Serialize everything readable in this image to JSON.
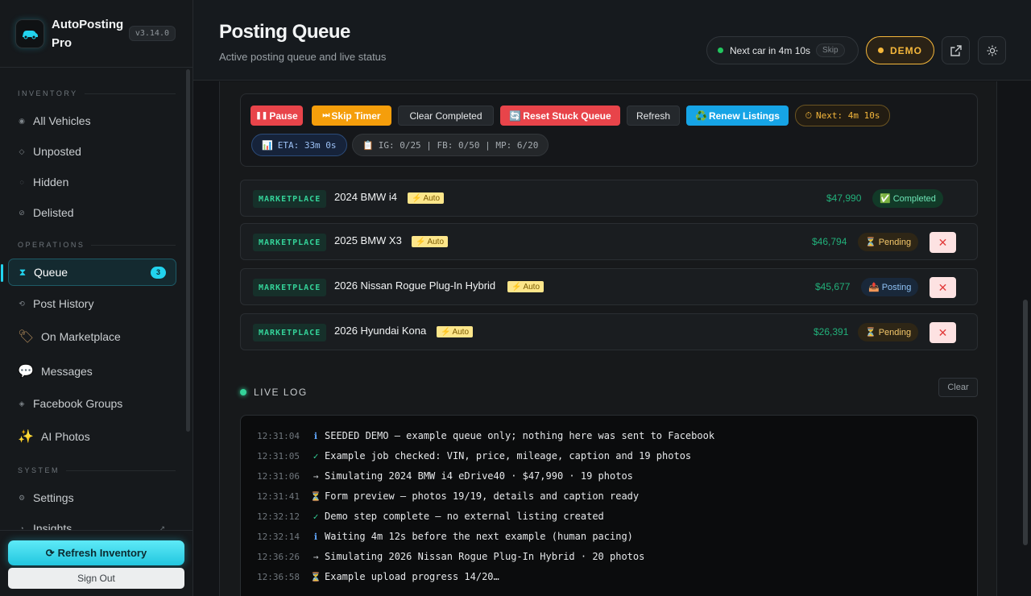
{
  "app": {
    "name": "AutoPosting Pro",
    "version": "v3.14.0"
  },
  "sidebar": {
    "sections": {
      "inventory": "INVENTORY",
      "operations": "OPERATIONS",
      "system": "SYSTEM"
    },
    "items": {
      "all_vehicles": "All Vehicles",
      "unposted": "Unposted",
      "hidden": "Hidden",
      "delisted": "Delisted",
      "queue": "Queue",
      "queue_count": "3",
      "post_history": "Post History",
      "on_marketplace": "On Marketplace",
      "messages": "Messages",
      "facebook_groups": "Facebook Groups",
      "ai_photos": "AI Photos",
      "settings": "Settings",
      "insights": "Insights"
    },
    "refresh_label": "Refresh Inventory",
    "signout_label": "Sign Out"
  },
  "header": {
    "title": "Posting Queue",
    "subtitle": "Active posting queue and live status",
    "next_car": "Next car in 4m 10s",
    "skip": "Skip",
    "demo": "DEMO"
  },
  "controls": {
    "pause": "Pause",
    "skip_timer": "Skip Timer",
    "clear_completed": "Clear Completed",
    "reset_stuck": "Reset Stuck Queue",
    "refresh": "Refresh",
    "renew": "Renew Listings",
    "next": "Next: 4m 10s",
    "eta": "ETA: 33m 0s",
    "counts": "IG: 0/25 | FB: 0/50 | MP: 6/20"
  },
  "queue": [
    {
      "tag": "MARKETPLACE",
      "name": "2024 BMW i4",
      "auto": "Auto",
      "price": "$47,990",
      "status": "Completed",
      "status_icon": "✅",
      "status_type": "completed",
      "removable": false
    },
    {
      "tag": "MARKETPLACE",
      "name": "2025 BMW X3",
      "auto": "Auto",
      "price": "$46,794",
      "status": "Pending",
      "status_icon": "⏳",
      "status_type": "pending",
      "removable": true
    },
    {
      "tag": "MARKETPLACE",
      "name": "2026 Nissan Rogue Plug-In Hybrid",
      "auto": "Auto",
      "price": "$45,677",
      "status": "Posting",
      "status_icon": "📤",
      "status_type": "posting",
      "removable": true
    },
    {
      "tag": "MARKETPLACE",
      "name": "2026 Hyundai Kona",
      "auto": "Auto",
      "price": "$26,391",
      "status": "Pending",
      "status_icon": "⏳",
      "status_type": "pending",
      "removable": true
    }
  ],
  "live_log": {
    "title": "LIVE LOG",
    "clear": "Clear",
    "lines": [
      {
        "time": "12:31:04",
        "icon": "ℹ",
        "type": "info",
        "text": "SEEDED DEMO — example queue only; nothing here was sent to Facebook"
      },
      {
        "time": "12:31:05",
        "icon": "✓",
        "type": "ok",
        "text": "Example job checked: VIN, price, mileage, caption and 19 photos"
      },
      {
        "time": "12:31:06",
        "icon": "→",
        "type": "arr",
        "text": "Simulating 2024 BMW i4 eDrive40 · $47,990 · 19 photos"
      },
      {
        "time": "12:31:41",
        "icon": "⏳",
        "type": "wait",
        "text": "Form preview — photos 19/19, details and caption ready"
      },
      {
        "time": "12:32:12",
        "icon": "✓",
        "type": "ok",
        "text": "Demo step complete — no external listing created"
      },
      {
        "time": "12:32:14",
        "icon": "ℹ",
        "type": "info",
        "text": "Waiting 4m 12s before the next example (human pacing)"
      },
      {
        "time": "12:36:26",
        "icon": "→",
        "type": "arr",
        "text": "Simulating 2026 Nissan Rogue Plug-In Hybrid · 20 photos"
      },
      {
        "time": "12:36:58",
        "icon": "⏳",
        "type": "wait",
        "text": "Example upload progress 14/20…"
      }
    ]
  },
  "colors": {
    "accent": "#22d3ee",
    "demo": "#f5b73b",
    "price": "#22b07a",
    "danger": "#e8444a"
  }
}
